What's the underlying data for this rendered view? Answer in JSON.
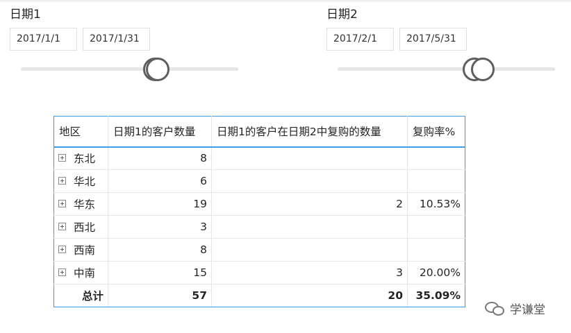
{
  "slicers": [
    {
      "title": "日期1",
      "start": "2017/1/1",
      "end": "2017/1/31"
    },
    {
      "title": "日期2",
      "start": "2017/2/1",
      "end": "2017/5/31"
    }
  ],
  "matrix": {
    "headers": [
      "地区",
      "日期1的客户数量",
      "日期1的客户在日期2中复购的数量",
      "复购率%"
    ],
    "rows": [
      {
        "region": "东北",
        "customers": "8",
        "repurchase": "",
        "rate": ""
      },
      {
        "region": "华北",
        "customers": "6",
        "repurchase": "",
        "rate": ""
      },
      {
        "region": "华东",
        "customers": "19",
        "repurchase": "2",
        "rate": "10.53%"
      },
      {
        "region": "西北",
        "customers": "3",
        "repurchase": "",
        "rate": ""
      },
      {
        "region": "西南",
        "customers": "8",
        "repurchase": "",
        "rate": ""
      },
      {
        "region": "中南",
        "customers": "15",
        "repurchase": "3",
        "rate": "20.00%"
      }
    ],
    "total": {
      "label": "总计",
      "customers": "57",
      "repurchase": "20",
      "rate": "35.09%"
    }
  },
  "watermark": {
    "text": "学谦堂",
    "icon": "wechat-icon"
  }
}
